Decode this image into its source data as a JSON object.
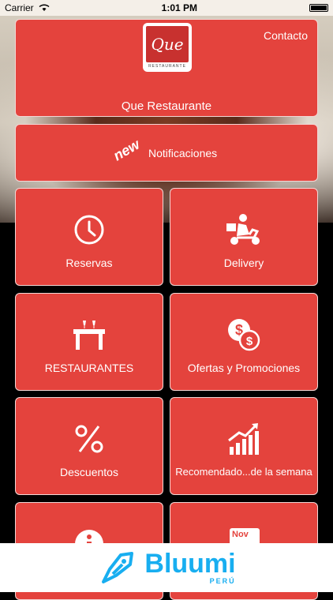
{
  "status_bar": {
    "carrier": "Carrier",
    "time": "1:01 PM"
  },
  "header": {
    "logo_text": "Que",
    "logo_subtext": "RESTAURANTE",
    "contact_label": "Contacto",
    "title": "Que Restaurante"
  },
  "notifications": {
    "badge": "new",
    "label": "Notificaciones"
  },
  "menu": {
    "reservas": "Reservas",
    "delivery": "Delivery",
    "restaurantes": "RESTAURANTES",
    "ofertas": "Ofertas y Promociones",
    "descuentos": "Descuentos",
    "recomendados": "Recomendado...de la semana",
    "calendar_month": "Nov"
  },
  "footer": {
    "brand": "Bluumi",
    "country": "PERÚ"
  },
  "colors": {
    "tile": "#e4433d",
    "brand": "#18aef0"
  }
}
